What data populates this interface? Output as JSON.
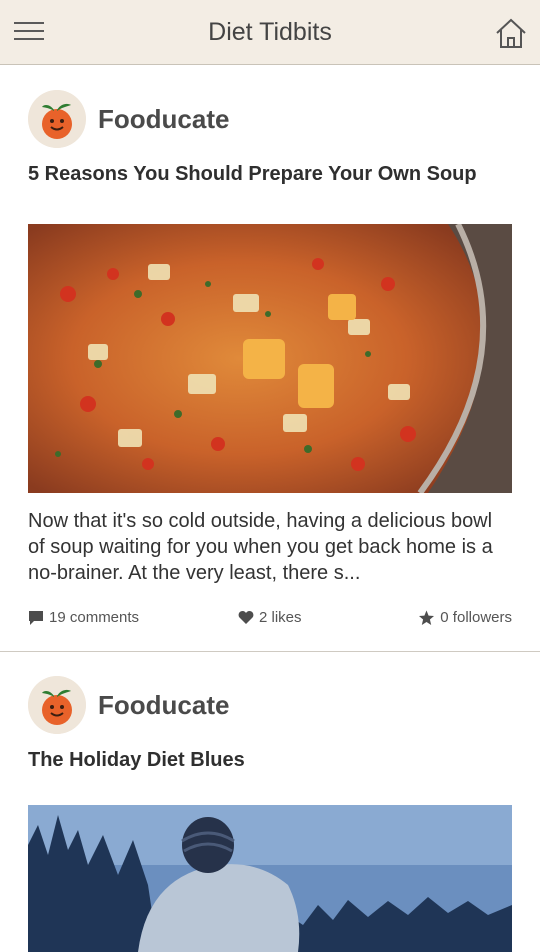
{
  "header": {
    "title": "Diet Tidbits"
  },
  "posts": [
    {
      "author": "Fooducate",
      "headline": "5 Reasons You Should Prepare Your Own Soup",
      "excerpt": "Now that it's so cold outside, having a delicious bowl of soup waiting for you when you get back home is a no-brainer. At the very least, there s...",
      "comments": "19 comments",
      "likes": "2 likes",
      "followers": "0 followers"
    },
    {
      "author": "Fooducate",
      "headline": "The Holiday Diet Blues"
    }
  ],
  "icons": {
    "menu": "hamburger-icon",
    "home": "home-icon",
    "comment": "comment-icon",
    "like": "heart-icon",
    "follow": "star-icon"
  }
}
